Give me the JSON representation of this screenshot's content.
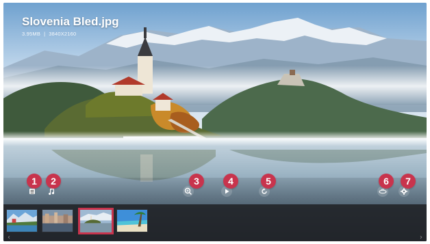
{
  "file": {
    "name": "Slovenia Bled.jpg",
    "size": "3.95MB",
    "separator": "|",
    "resolution": "3840X2160"
  },
  "controls": [
    {
      "id": "list",
      "icon": "list-icon",
      "badge": "1"
    },
    {
      "id": "music",
      "icon": "music-note-icon",
      "badge": "2"
    },
    {
      "id": "zoom",
      "icon": "zoom-in-icon",
      "badge": "3"
    },
    {
      "id": "play",
      "icon": "play-icon",
      "badge": "4"
    },
    {
      "id": "rotate",
      "icon": "rotate-icon",
      "badge": "5"
    },
    {
      "id": "360",
      "icon": "vr-360-icon",
      "badge": "6"
    },
    {
      "id": "settings",
      "icon": "gear-icon",
      "badge": "7"
    }
  ],
  "thumbnails": [
    {
      "label": "lake mountain village",
      "selected": false
    },
    {
      "label": "city waterfront",
      "selected": false
    },
    {
      "label": "Slovenia Bled",
      "selected": true
    },
    {
      "label": "tropical beach",
      "selected": false
    }
  ],
  "nav": {
    "prev": "‹",
    "next": "›"
  },
  "colors": {
    "accent": "#c8344d",
    "strip": "#202226"
  }
}
